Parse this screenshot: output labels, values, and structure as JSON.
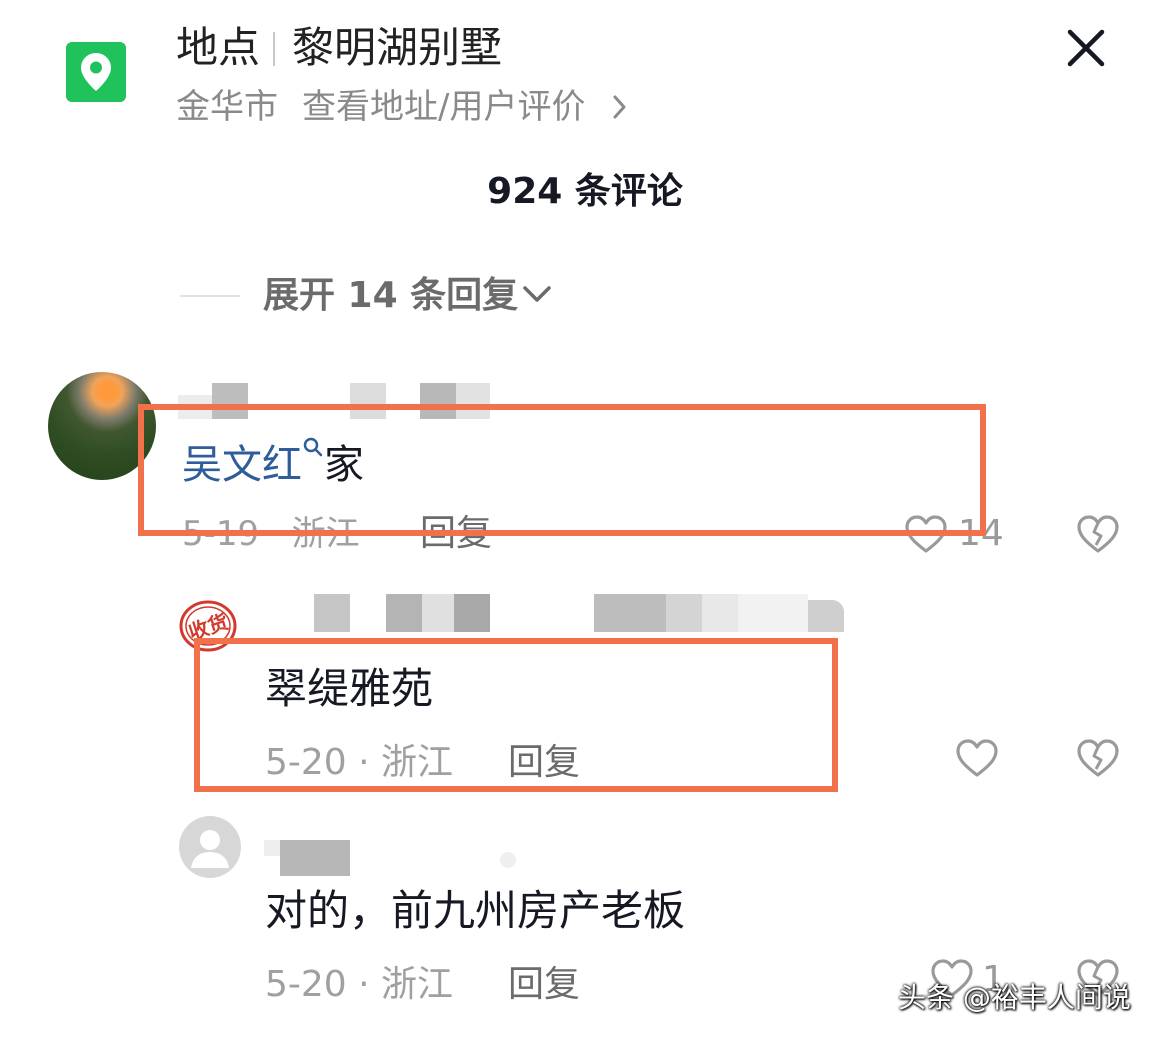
{
  "header": {
    "label": "地点",
    "place_name": "黎明湖别墅",
    "city": "金华市",
    "address_link": "查看地址/用户评价",
    "location_icon": "map-pin-icon",
    "close_icon": "close-icon"
  },
  "comments_header": {
    "count_text": "924 条评论"
  },
  "expand": {
    "text": "展开 14 条回复"
  },
  "comments": [
    {
      "text_link": "吴文红",
      "text_rest": "家",
      "meta": "5-19 · 浙江",
      "reply_label": "回复",
      "likes": "14"
    },
    {
      "badge": "收货",
      "text": "翠缇雅苑",
      "meta": "5-20 · 浙江",
      "reply_label": "回复"
    },
    {
      "text": "对的，前九州房产老板",
      "meta": "5-20 · 浙江",
      "reply_label": "回复",
      "likes": "1"
    }
  ],
  "watermark": "头条 @裕丰人间说",
  "colors": {
    "accent_green": "#20c35b",
    "link_blue": "#2f5d9a",
    "highlight_orange": "#f3714a"
  }
}
